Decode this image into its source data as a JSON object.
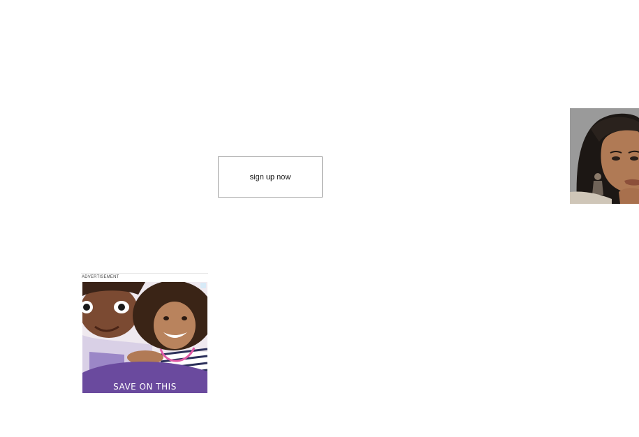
{
  "signup": {
    "label": "sign up now"
  },
  "portrait": {
    "icon": "portrait-photo-icon"
  },
  "advertisement": {
    "label": "ADVERTISEMENT",
    "banner_text": "SAVE ON THIS",
    "adchoices_icon": "adchoices-icon",
    "accent_color": "#6a4a9e"
  }
}
